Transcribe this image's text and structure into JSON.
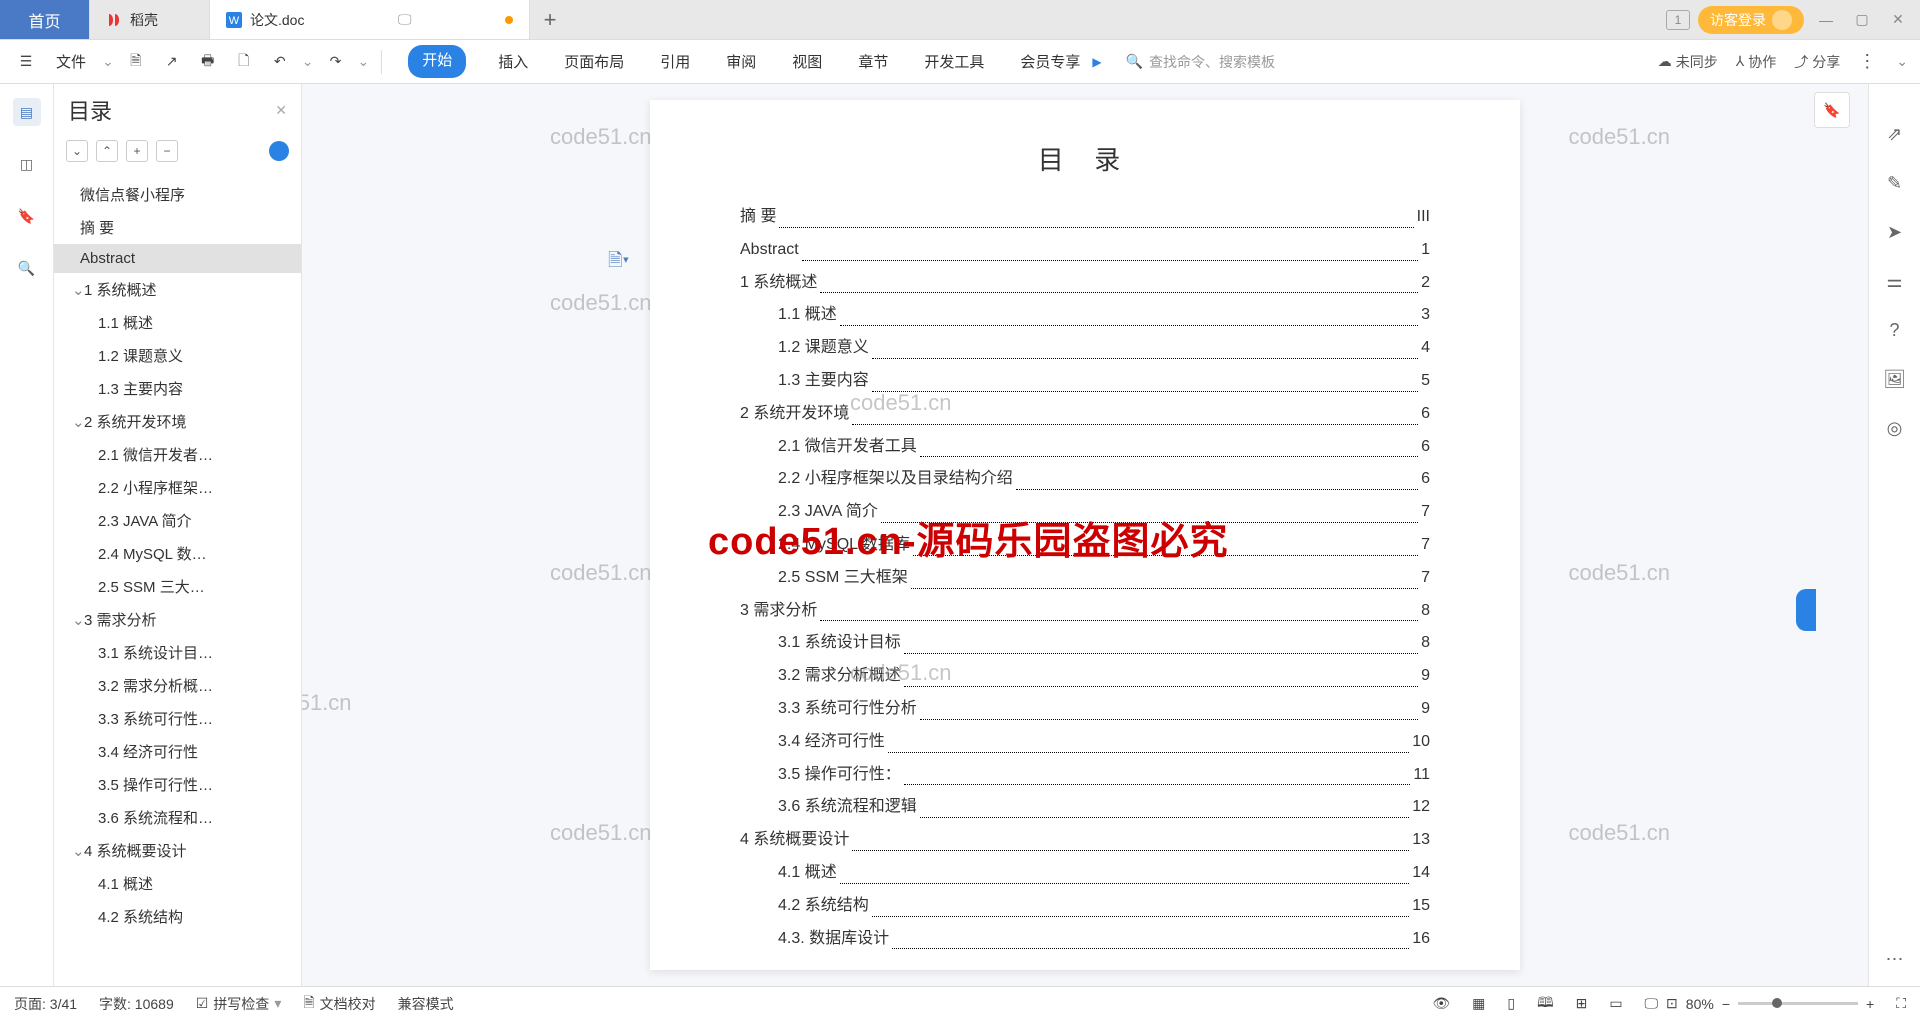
{
  "tabs": {
    "home": "首页",
    "docket": "稻壳",
    "doc": "论文.doc"
  },
  "titlebar": {
    "counter": "1",
    "login": "访客登录"
  },
  "ribbon": {
    "file": "文件",
    "menu": [
      "开始",
      "插入",
      "页面布局",
      "引用",
      "审阅",
      "视图",
      "章节",
      "开发工具",
      "会员专享"
    ],
    "search_placeholder": "查找命令、搜索模板",
    "unsync": "未同步",
    "collab": "协作",
    "share": "分享"
  },
  "outline": {
    "title": "目录",
    "items": [
      {
        "label": "微信点餐小程序",
        "level": 1
      },
      {
        "label": "摘 要",
        "level": 1
      },
      {
        "label": "Abstract",
        "level": 1,
        "selected": true
      },
      {
        "label": "1 系统概述",
        "level": 2,
        "chev": true
      },
      {
        "label": "1.1 概述",
        "level": 3
      },
      {
        "label": "1.2 课题意义",
        "level": 3
      },
      {
        "label": "1.3 主要内容",
        "level": 3
      },
      {
        "label": "2 系统开发环境",
        "level": 2,
        "chev": true
      },
      {
        "label": "2.1 微信开发者…",
        "level": 3
      },
      {
        "label": "2.2 小程序框架…",
        "level": 3
      },
      {
        "label": "2.3 JAVA 简介",
        "level": 3
      },
      {
        "label": "2.4 MySQL 数…",
        "level": 3
      },
      {
        "label": "2.5 SSM 三大…",
        "level": 3
      },
      {
        "label": "3 需求分析",
        "level": 2,
        "chev": true
      },
      {
        "label": "3.1 系统设计目…",
        "level": 3
      },
      {
        "label": "3.2 需求分析概…",
        "level": 3
      },
      {
        "label": "3.3 系统可行性…",
        "level": 3
      },
      {
        "label": "3.4 经济可行性",
        "level": 3
      },
      {
        "label": "3.5 操作可行性…",
        "level": 3
      },
      {
        "label": "3.6 系统流程和…",
        "level": 3
      },
      {
        "label": "4 系统概要设计",
        "level": 2,
        "chev": true
      },
      {
        "label": "4.1 概述",
        "level": 3
      },
      {
        "label": "4.2 系统结构",
        "level": 3
      }
    ]
  },
  "doc": {
    "title": "目 录",
    "toc": [
      {
        "label": "摘 要",
        "page": "III",
        "ind": 0
      },
      {
        "label": "Abstract",
        "page": "1",
        "ind": 0
      },
      {
        "label": "1 系统概述",
        "page": "2",
        "ind": 0
      },
      {
        "label": "1.1 概述",
        "page": "3",
        "ind": 1
      },
      {
        "label": "1.2 课题意义",
        "page": "4",
        "ind": 1
      },
      {
        "label": "1.3 主要内容",
        "page": "5",
        "ind": 1
      },
      {
        "label": "2 系统开发环境",
        "page": "6",
        "ind": 0
      },
      {
        "label": "2.1 微信开发者工具",
        "page": "6",
        "ind": 1
      },
      {
        "label": "2.2 小程序框架以及目录结构介绍",
        "page": "6",
        "ind": 1
      },
      {
        "label": "2.3 JAVA 简介",
        "page": "7",
        "ind": 1
      },
      {
        "label": "2.4 MySQL 数据库",
        "page": "7",
        "ind": 1
      },
      {
        "label": "2.5 SSM 三大框架",
        "page": "7",
        "ind": 1
      },
      {
        "label": "3 需求分析",
        "page": "8",
        "ind": 0
      },
      {
        "label": "3.1 系统设计目标",
        "page": "8",
        "ind": 1
      },
      {
        "label": "3.2 需求分析概述",
        "page": "9",
        "ind": 1
      },
      {
        "label": "3.3 系统可行性分析",
        "page": "9",
        "ind": 1
      },
      {
        "label": "3.4 经济可行性",
        "page": "10",
        "ind": 1
      },
      {
        "label": "3.5 操作可行性：",
        "page": "11",
        "ind": 1
      },
      {
        "label": "3.6 系统流程和逻辑",
        "page": "12",
        "ind": 1
      },
      {
        "label": "4 系统概要设计",
        "page": "13",
        "ind": 0
      },
      {
        "label": "4.1 概述",
        "page": "14",
        "ind": 1
      },
      {
        "label": "4.2 系统结构",
        "page": "15",
        "ind": 1
      },
      {
        "label": "4.3. 数据库设计",
        "page": "16",
        "ind": 1
      }
    ],
    "watermark": "code51.cn",
    "watermark_big": "code51.cn-源码乐园盗图必究"
  },
  "status": {
    "page": "页面: 3/41",
    "words": "字数: 10689",
    "spell": "拼写检查",
    "proofread": "文档校对",
    "compat": "兼容模式",
    "zoom": "80%"
  }
}
